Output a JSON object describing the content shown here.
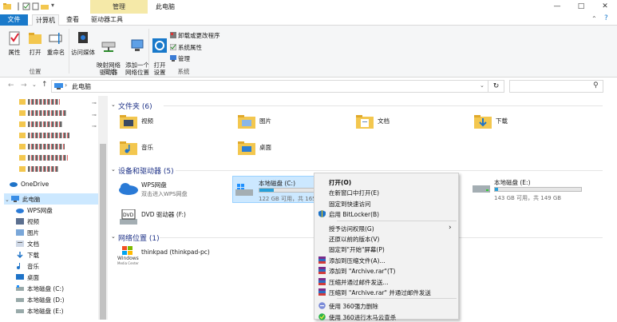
{
  "title": {
    "manage_tab": "管理",
    "window_title": "此电脑",
    "minimize": "—",
    "maximize": "□",
    "close": "✕"
  },
  "tabs": [
    "文件",
    "计算机",
    "查看",
    "驱动器工具"
  ],
  "ribbon": {
    "location": {
      "buttons": [
        "属性",
        "打开",
        "重命名"
      ],
      "group": "位置"
    },
    "network": {
      "buttons": [
        "访问媒体",
        "映射网络\n驱动器",
        "添加一个\n网络位置"
      ],
      "group": "网络"
    },
    "system": {
      "open_settings": "打开\n设置",
      "small": [
        "卸载或更改程序",
        "系统属性",
        "管理"
      ],
      "group": "系统"
    }
  },
  "address": {
    "path": "此电脑",
    "refresh": "↻",
    "search_placeholder": ""
  },
  "nav": {
    "onedrive": "OneDrive",
    "this_pc": "此电脑",
    "items": [
      "WPS网盘",
      "视频",
      "图片",
      "文档",
      "下载",
      "音乐",
      "桌面",
      "本地磁盘 (C:)",
      "本地磁盘 (D:)",
      "本地磁盘 (E:)"
    ]
  },
  "sections": {
    "folders": "文件夹 (6)",
    "devices": "设备和驱动器 (5)",
    "network": "网络位置 (1)"
  },
  "folders": [
    "视频",
    "图片",
    "文档",
    "下载",
    "音乐",
    "桌面"
  ],
  "devices": {
    "wps": {
      "name": "WPS网盘",
      "desc": "双击进入WPS网盘"
    },
    "c": {
      "name": "本地磁盘 (C:)",
      "free": "122 GB 可用，共 165",
      "used_pct": 26
    },
    "e": {
      "name": "本地磁盘 (E:)",
      "free": "143 GB 可用，共 149 GB",
      "used_pct": 4
    },
    "dvd": {
      "name": "DVD 驱动器 (F:)"
    }
  },
  "network_items": [
    {
      "name": "thinkpad (thinkpad-pc)",
      "logo": "Windows",
      "logo_sub": "Media Center"
    }
  ],
  "context_menu": [
    {
      "label": "打开(O)",
      "bold": true
    },
    {
      "label": "在新窗口中打开(E)"
    },
    {
      "label": "固定到快速访问"
    },
    {
      "label": "启用 BitLocker(B)",
      "icon": "shield-icon"
    },
    {
      "sep": true
    },
    {
      "label": "授予访问权限(G)",
      "submenu": true
    },
    {
      "label": "还原以前的版本(V)"
    },
    {
      "label": "固定到\"开始\"屏幕(P)"
    },
    {
      "label": "添加到压缩文件(A)...",
      "icon": "rar-icon"
    },
    {
      "label": "添加到 \"Archive.rar\"(T)",
      "icon": "rar-icon"
    },
    {
      "label": "压缩并通过邮件发送...",
      "icon": "rar-icon"
    },
    {
      "label": "压缩到 \"Archive.rar\" 并通过邮件发送",
      "icon": "rar-icon"
    },
    {
      "sep": true
    },
    {
      "label": "使用 360强力删除",
      "icon": "360-icon"
    },
    {
      "label": "使用 360进行木马云查杀",
      "icon": "360-scan-icon"
    }
  ],
  "colors": {
    "accent": "#1979ca",
    "manage_tab": "#f5e9a8",
    "drive_fill": "#26a0da",
    "folder": "#f3c74f",
    "selected": "#cce8ff"
  }
}
